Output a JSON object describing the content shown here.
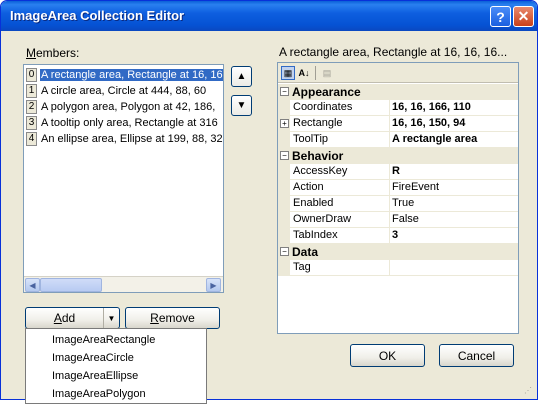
{
  "window": {
    "title": "ImageArea Collection Editor"
  },
  "members": {
    "label": "Members:",
    "label_accel": "M",
    "label_rest": "embers:",
    "items": [
      {
        "index": "0",
        "text": "A rectangle area, Rectangle at 16, 16",
        "selected": true
      },
      {
        "index": "1",
        "text": "A circle area, Circle at 444, 88, 60"
      },
      {
        "index": "2",
        "text": "A polygon area, Polygon at 42, 186,"
      },
      {
        "index": "3",
        "text": "A tooltip only area, Rectangle at 316"
      },
      {
        "index": "4",
        "text": "An ellipse area, Ellipse at 199, 88, 32"
      }
    ]
  },
  "buttons": {
    "add_accel": "A",
    "add_rest": "dd",
    "remove_accel": "R",
    "remove_rest": "emove",
    "ok": "OK",
    "cancel": "Cancel",
    "move_up": "▲",
    "move_down": "▼"
  },
  "add_menu": {
    "items": [
      "ImageAreaRectangle",
      "ImageAreaCircle",
      "ImageAreaEllipse",
      "ImageAreaPolygon"
    ]
  },
  "property_grid": {
    "selected_object": "A rectangle area, Rectangle at 16, 16, 16...",
    "rows": [
      {
        "kind": "category",
        "label": "Appearance"
      },
      {
        "kind": "prop",
        "name": "Coordinates",
        "value": "16, 16, 166, 110",
        "bold": true
      },
      {
        "kind": "prop",
        "name": "Rectangle",
        "value": "16, 16, 150, 94",
        "bold": true,
        "expandable": true
      },
      {
        "kind": "prop",
        "name": "ToolTip",
        "value": "A rectangle area",
        "bold": true
      },
      {
        "kind": "category",
        "label": "Behavior"
      },
      {
        "kind": "prop",
        "name": "AccessKey",
        "value": "R",
        "bold": true
      },
      {
        "kind": "prop",
        "name": "Action",
        "value": "FireEvent",
        "bold": false
      },
      {
        "kind": "prop",
        "name": "Enabled",
        "value": "True",
        "bold": false
      },
      {
        "kind": "prop",
        "name": "OwnerDraw",
        "value": "False",
        "bold": false
      },
      {
        "kind": "prop",
        "name": "TabIndex",
        "value": "3",
        "bold": true
      },
      {
        "kind": "category",
        "label": "Data"
      },
      {
        "kind": "prop",
        "name": "Tag",
        "value": "",
        "bold": false
      }
    ]
  },
  "colors": {
    "title_bar": "#0552d4",
    "selection": "#316ac5",
    "dialog_face": "#ece9d8"
  }
}
